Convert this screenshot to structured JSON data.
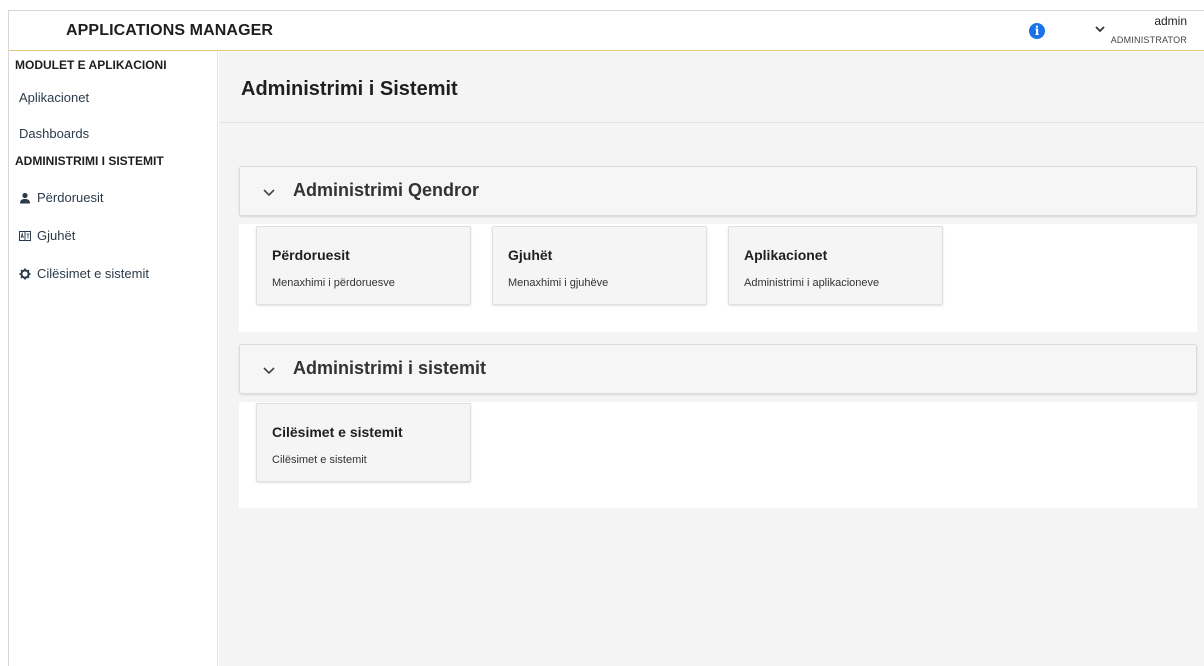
{
  "header": {
    "app_title": "APPLICATIONS MANAGER",
    "user_name": "admin",
    "user_role": "ADMINISTRATOR"
  },
  "sidebar": {
    "sections": [
      {
        "title": "MODULET E APLIKACIONI",
        "items": [
          {
            "label": "Aplikacionet",
            "icon": ""
          },
          {
            "label": "Dashboards",
            "icon": ""
          }
        ]
      },
      {
        "title": "ADMINISTRIMI I SISTEMIT",
        "items": [
          {
            "label": "Përdoruesit",
            "icon": "user-icon"
          },
          {
            "label": "Gjuhët",
            "icon": "language-icon"
          },
          {
            "label": "Cilësimet e sistemit",
            "icon": "gear-icon"
          }
        ]
      }
    ]
  },
  "main": {
    "page_title": "Administrimi i Sistemit",
    "sections": [
      {
        "title": "Administrimi Qendror",
        "cards": [
          {
            "title": "Përdoruesit",
            "description": "Menaxhimi i përdoruesve"
          },
          {
            "title": "Gjuhët",
            "description": "Menaxhimi i gjuhëve"
          },
          {
            "title": "Aplikacionet",
            "description": "Administrimi i aplikacioneve"
          }
        ]
      },
      {
        "title": "Administrimi i sistemit",
        "cards": [
          {
            "title": "Cilësimet e sistemit",
            "description": "Cilësimet e sistemit"
          }
        ]
      }
    ]
  },
  "colors": {
    "accent_border": "#e2c97a",
    "info_blue": "#1a73e8",
    "background": "#f4f4f4"
  }
}
